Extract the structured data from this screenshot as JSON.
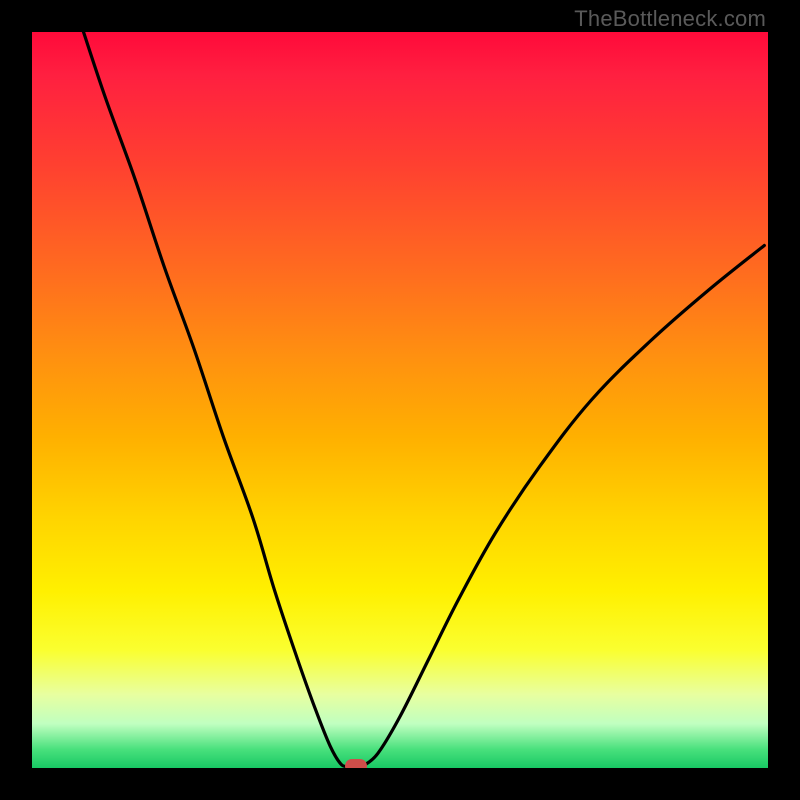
{
  "watermark": "TheBottleneck.com",
  "chart_data": {
    "type": "line",
    "title": "",
    "xlabel": "",
    "ylabel": "",
    "xlim": [
      0,
      100
    ],
    "ylim": [
      0,
      100
    ],
    "series": [
      {
        "name": "curve-left",
        "x": [
          7,
          10,
          14,
          18,
          22,
          26,
          30,
          33,
          36,
          38.5,
          40.5,
          42,
          43
        ],
        "values": [
          100,
          91,
          80,
          68,
          57,
          45,
          34,
          24,
          15,
          8,
          3,
          0.5,
          0
        ]
      },
      {
        "name": "curve-right",
        "x": [
          45,
          47,
          50,
          54,
          58,
          63,
          69,
          76,
          84,
          92,
          99.5
        ],
        "values": [
          0,
          2,
          7,
          15,
          23,
          32,
          41,
          50,
          58,
          65,
          71
        ]
      }
    ],
    "marker": {
      "x": 44,
      "y": 0,
      "color": "#cf4e4a"
    },
    "gradient_colors": {
      "top": "#ff0a3a",
      "mid1": "#ff9010",
      "mid2": "#fff000",
      "bottom": "#18c864"
    }
  }
}
